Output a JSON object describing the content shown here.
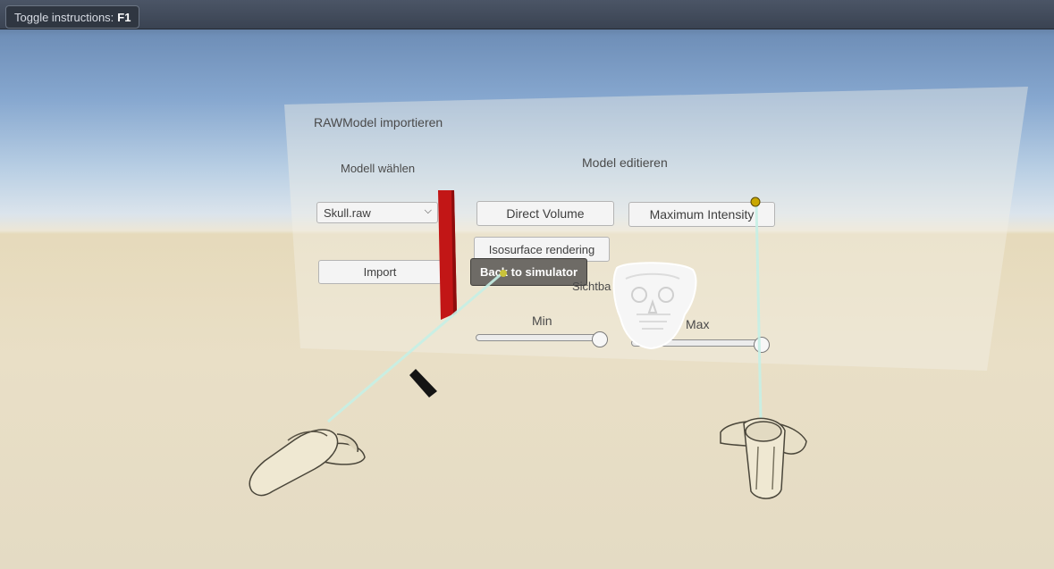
{
  "toolbar": {
    "toggle_label": "Toggle instructions:",
    "toggle_key": "F1"
  },
  "panel": {
    "title": "RAWModel importieren",
    "model_select_heading": "Modell wählen",
    "model_select_value": "Skull.raw",
    "import_label": "Import",
    "edit_heading": "Model editieren",
    "direct_volume_label": "Direct Volume",
    "max_intensity_label": "Maximum Intensity",
    "isosurface_label": "Isosurface rendering",
    "back_label": "Back to simulator",
    "visibility_label": "Sichtba",
    "min_label": "Min",
    "max_label": "Max",
    "min_slider_value": 1.0,
    "max_slider_value": 1.0
  },
  "colors": {
    "sky_top": "#6f8fb8",
    "ground": "#e5dcc4",
    "laser": "#bfeee4",
    "red_bar": "#c21616",
    "controller": "#efe8d2"
  }
}
